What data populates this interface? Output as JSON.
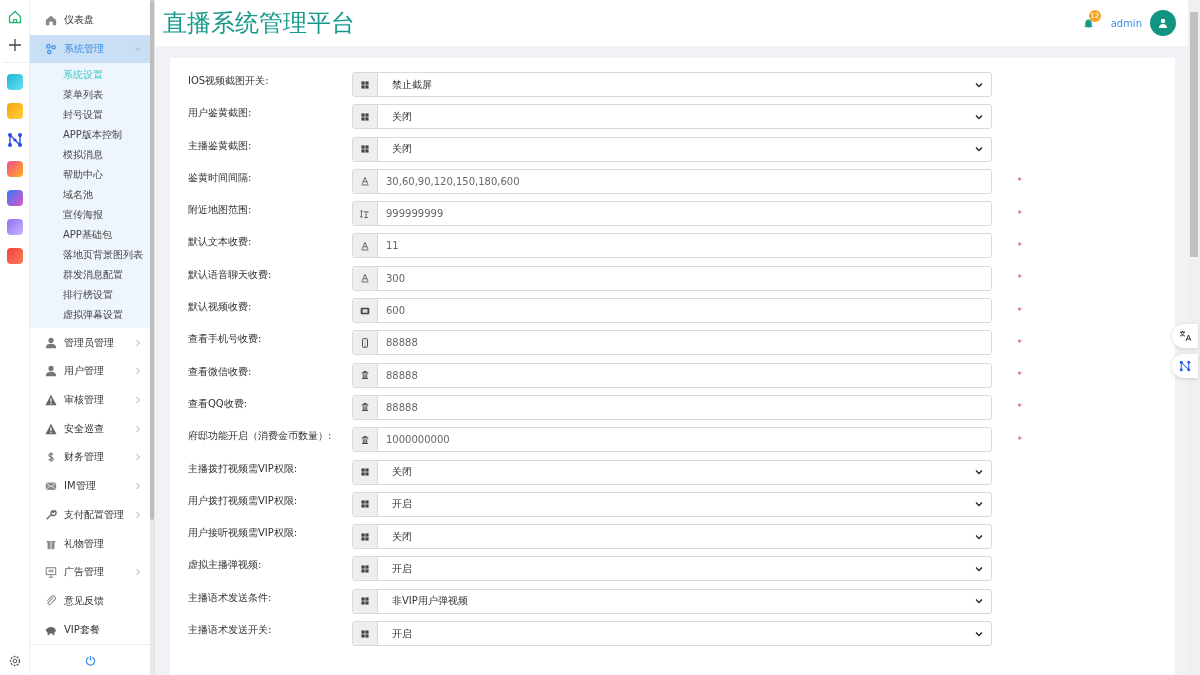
{
  "header": {
    "title": "直播系统管理平台",
    "notification_count": "12",
    "user": "admin"
  },
  "sidebar": {
    "items": [
      {
        "label": "仪表盘",
        "expanded": false,
        "has_children": false
      },
      {
        "label": "系统管理",
        "expanded": true,
        "has_children": true,
        "children": [
          {
            "label": "系统设置",
            "selected": true
          },
          {
            "label": "菜单列表",
            "selected": false
          },
          {
            "label": "封号设置",
            "selected": false
          },
          {
            "label": "APP版本控制",
            "selected": false
          },
          {
            "label": "模拟消息",
            "selected": false
          },
          {
            "label": "帮助中心",
            "selected": false
          },
          {
            "label": "域名池",
            "selected": false
          },
          {
            "label": "宣传海报",
            "selected": false
          },
          {
            "label": "APP基础包",
            "selected": false
          },
          {
            "label": "落地页背景图列表",
            "selected": false
          },
          {
            "label": "群发消息配置",
            "selected": false
          },
          {
            "label": "排行榜设置",
            "selected": false
          },
          {
            "label": "虚拟弹幕设置",
            "selected": false
          }
        ]
      },
      {
        "label": "管理员管理",
        "expanded": false,
        "has_children": true
      },
      {
        "label": "用户管理",
        "expanded": false,
        "has_children": true
      },
      {
        "label": "审核管理",
        "expanded": false,
        "has_children": true
      },
      {
        "label": "安全巡查",
        "expanded": false,
        "has_children": true
      },
      {
        "label": "财务管理",
        "expanded": false,
        "has_children": true
      },
      {
        "label": "IM管理",
        "expanded": false,
        "has_children": true
      },
      {
        "label": "支付配置管理",
        "expanded": false,
        "has_children": true
      },
      {
        "label": "礼物管理",
        "expanded": false,
        "has_children": false
      },
      {
        "label": "广告管理",
        "expanded": false,
        "has_children": true
      },
      {
        "label": "意见反馈",
        "expanded": false,
        "has_children": false
      },
      {
        "label": "VIP套餐",
        "expanded": false,
        "has_children": false
      }
    ]
  },
  "form": {
    "fields": [
      {
        "label": "IOS视频截图开关:",
        "kind": "select",
        "value": "禁止截屏"
      },
      {
        "label": "用户鉴黄截图:",
        "kind": "select",
        "value": "关闭"
      },
      {
        "label": "主播鉴黄截图:",
        "kind": "select",
        "value": "关闭"
      },
      {
        "label": "鉴黄时间间隔:",
        "kind": "text-font",
        "value": "30,60,90,120,150,180,600",
        "required_mark": "*"
      },
      {
        "label": "附近地图范围:",
        "kind": "text-height",
        "value": "999999999",
        "required_mark": "*"
      },
      {
        "label": "默认文本收费:",
        "kind": "text-font",
        "value": "11",
        "required_mark": "*"
      },
      {
        "label": "默认语音聊天收费:",
        "kind": "text-font",
        "value": "300",
        "required_mark": "*"
      },
      {
        "label": "默认视频收费:",
        "kind": "text-film",
        "value": "600",
        "required_mark": "*"
      },
      {
        "label": "查看手机号收费:",
        "kind": "text-phone",
        "value": "88888",
        "required_mark": "*"
      },
      {
        "label": "查看微信收费:",
        "kind": "text-bank",
        "value": "88888",
        "required_mark": "*"
      },
      {
        "label": "查看QQ收费:",
        "kind": "text-bank",
        "value": "88888",
        "required_mark": "*"
      },
      {
        "label": "府邸功能开启（消费金币数量）:",
        "kind": "text-bank",
        "value": "1000000000",
        "required_mark": "*"
      },
      {
        "label": "主播拨打视频需VIP权限:",
        "kind": "select",
        "value": "关闭"
      },
      {
        "label": "用户拨打视频需VIP权限:",
        "kind": "select",
        "value": "开启"
      },
      {
        "label": "用户接听视频需VIP权限:",
        "kind": "select",
        "value": "关闭"
      },
      {
        "label": "虚拟主播弹视频:",
        "kind": "select",
        "value": "开启"
      },
      {
        "label": "主播语术发送条件:",
        "kind": "select",
        "value": "非VIP用户弹视频"
      },
      {
        "label": "主播语术发送开关:",
        "kind": "select",
        "value": "开启"
      }
    ]
  }
}
